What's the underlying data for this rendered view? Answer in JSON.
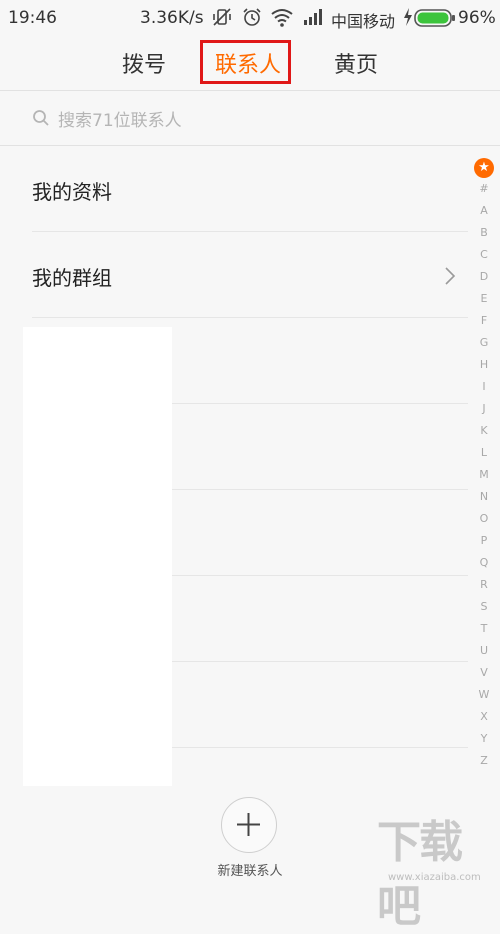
{
  "status": {
    "time": "19:46",
    "net_speed": "3.36K/s",
    "carrier": "中国移动",
    "battery": "96%",
    "icons": [
      "vibrate-off-icon",
      "alarm-icon",
      "wifi-icon",
      "signal-icon",
      "charging-icon",
      "battery-icon"
    ]
  },
  "tabs": [
    {
      "label": "拨号",
      "active": false
    },
    {
      "label": "联系人",
      "active": true
    },
    {
      "label": "黄页",
      "active": false
    }
  ],
  "search": {
    "placeholder": "搜索71位联系人"
  },
  "list": {
    "items": [
      {
        "label": "我的资料",
        "has_chevron": false
      },
      {
        "label": "我的群组",
        "has_chevron": true
      }
    ]
  },
  "alpha_index": {
    "star": "★",
    "letters": [
      "#",
      "A",
      "B",
      "C",
      "D",
      "E",
      "F",
      "G",
      "H",
      "I",
      "J",
      "K",
      "L",
      "M",
      "N",
      "O",
      "P",
      "Q",
      "R",
      "S",
      "T",
      "U",
      "V",
      "W",
      "X",
      "Y",
      "Z"
    ]
  },
  "bottom": {
    "add_label": "新建联系人"
  },
  "watermark": {
    "text": "下载吧",
    "url": "www.xiazaiba.com"
  },
  "colors": {
    "accent": "#ff6a00",
    "highlight_box": "#e01818"
  }
}
